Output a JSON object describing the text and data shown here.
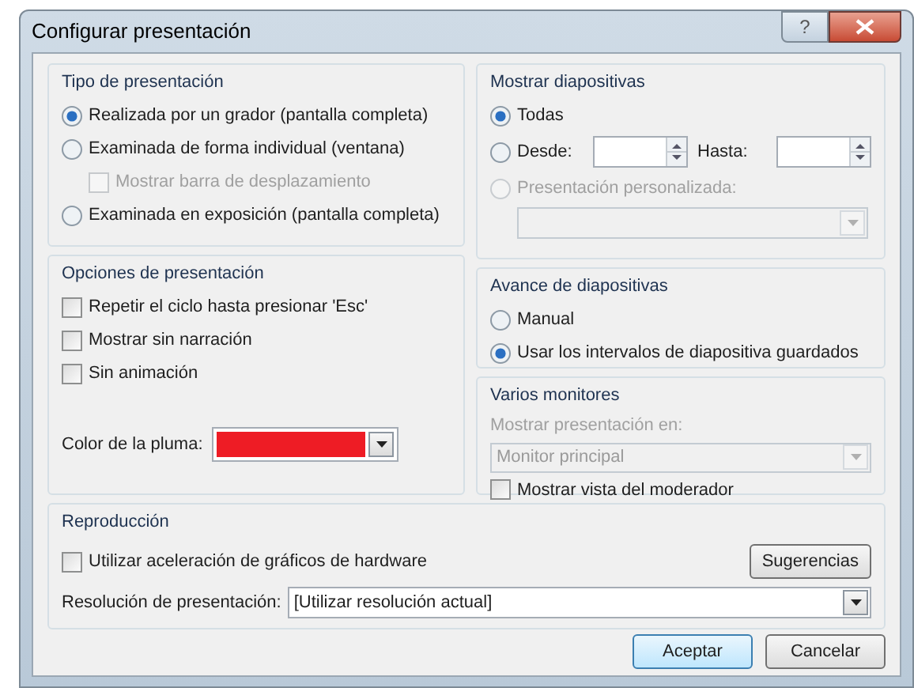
{
  "window": {
    "title": "Configurar presentación",
    "help_button": "?"
  },
  "show_type": {
    "title": "Tipo de presentación",
    "options": [
      {
        "kind": "radio",
        "label": "Realizada por un grador (pantalla completa)",
        "selected": true,
        "disabled": false
      },
      {
        "kind": "radio",
        "label": "Examinada de forma individual (ventana)",
        "selected": false,
        "disabled": false,
        "children": [
          {
            "kind": "checkbox",
            "label": "Mostrar barra de desplazamiento",
            "checked": false,
            "disabled": true
          }
        ]
      },
      {
        "kind": "radio",
        "label": "Examinada en exposición (pantalla completa)",
        "selected": false,
        "disabled": false
      }
    ]
  },
  "show_slides": {
    "title": "Mostrar diapositivas",
    "options": [
      {
        "kind": "radio",
        "label": "Todas",
        "selected": true,
        "disabled": false
      },
      {
        "kind": "range",
        "label": "Desde:",
        "selected": false,
        "disabled": false,
        "to_label": "Hasta:"
      },
      {
        "kind": "radio",
        "label": "Presentación personalizada:",
        "selected": false,
        "disabled": true
      }
    ],
    "custom_show": {
      "disabled": true
    }
  },
  "show_options": {
    "title": "Opciones de presentación",
    "options": [
      {
        "label": "Repetir el ciclo hasta presionar 'Esc'",
        "checked": false
      },
      {
        "label": "Mostrar sin narración",
        "checked": false
      },
      {
        "label": "Sin animación",
        "checked": false
      }
    ],
    "pen_color": {
      "label": "Color de la pluma:",
      "color": "#ee1c25"
    }
  },
  "advance": {
    "title": "Avance de diapositivas",
    "options": [
      {
        "label": "Manual",
        "selected": false
      },
      {
        "label": "Usar los intervalos de diapositiva guardados",
        "selected": true
      }
    ]
  },
  "monitors": {
    "title": "Varios monitores",
    "display_label": "Mostrar presentación en:",
    "display": {
      "value": "Monitor principal",
      "disabled": true
    },
    "presenter_view": {
      "label": "Mostrar vista del moderador",
      "checked": false
    }
  },
  "playback": {
    "title": "Reproducción",
    "hardware": {
      "label": "Utilizar aceleración de gráficos de hardware",
      "checked": false
    },
    "tips_button": "Sugerencias",
    "resolution_label": "Resolución de presentación:",
    "resolution": {
      "value": "[Utilizar resolución actual]"
    }
  },
  "buttons": [
    {
      "label": "Aceptar",
      "default": true
    },
    {
      "label": "Cancelar",
      "default": false
    }
  ]
}
